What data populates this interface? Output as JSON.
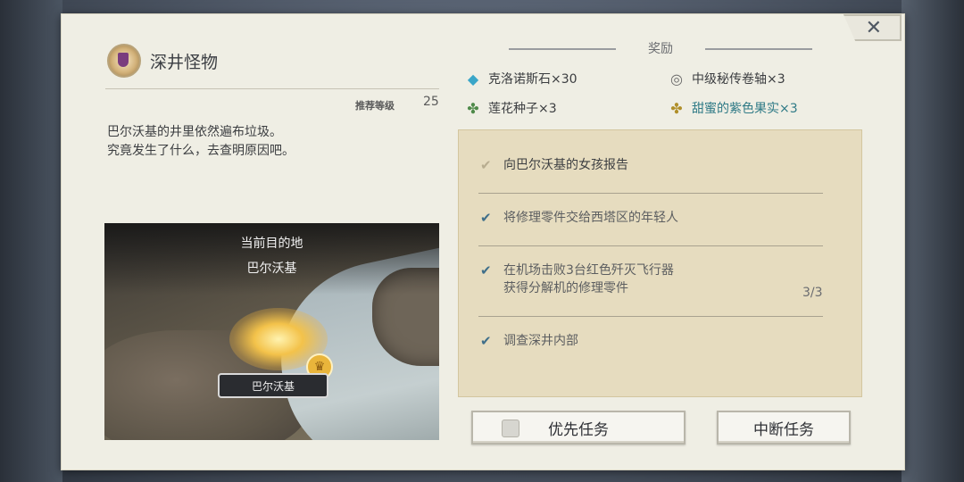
{
  "quest": {
    "title": "深井怪物",
    "level_label": "推荐等级",
    "level_value": "25",
    "description": [
      "巴尔沃基的井里依然遍布垃圾。",
      "究竟发生了什么，去查明原因吧。"
    ]
  },
  "map": {
    "current_label": "当前目的地",
    "destination": "巴尔沃基",
    "location_tag": "巴尔沃基"
  },
  "rewards": {
    "heading": "奖励",
    "items": [
      {
        "label": "克洛诺斯石×30",
        "icon": "crystal-icon"
      },
      {
        "label": "中级秘传卷轴×3",
        "icon": "scroll-icon"
      },
      {
        "label": "莲花种子×3",
        "icon": "leaf-icon"
      },
      {
        "label": "甜蜜的紫色果实×3",
        "icon": "fruit-icon",
        "color": "#2f7a86"
      }
    ]
  },
  "objectives": [
    {
      "lines": [
        "向巴尔沃基的女孩报告"
      ],
      "done": false
    },
    {
      "lines": [
        "将修理零件交给西塔区的年轻人"
      ],
      "done": true
    },
    {
      "lines": [
        "在机场击败3台红色歼灭飞行器",
        "获得分解机的修理零件"
      ],
      "done": true,
      "progress": "3/3"
    },
    {
      "lines": [
        "调查深井内部"
      ],
      "done": true
    }
  ],
  "buttons": {
    "priority": "优先任务",
    "abort": "中断任务",
    "close": "✕"
  },
  "colors": {
    "panel": "#efeee4",
    "objective_box": "#e6dcbf",
    "check": "#3f6f8a"
  }
}
